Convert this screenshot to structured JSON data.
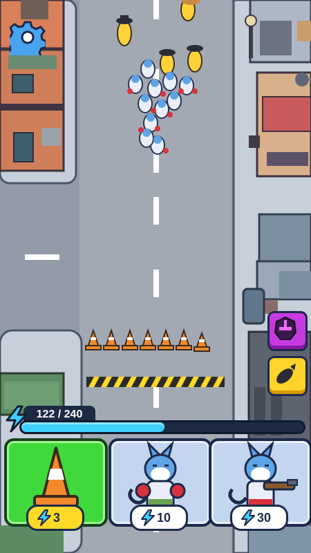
{
  "hud": {
    "energy": {
      "current": 122,
      "max": 240,
      "label": "122 / 240",
      "fill_fraction": 0.508
    },
    "settings_icon": "gear-icon",
    "power_icon": "mech-helmet-icon",
    "bomb_icon": "bomb-icon"
  },
  "cards": [
    {
      "unit": "traffic-cone",
      "cost": "3",
      "selected": true
    },
    {
      "unit": "boxer-cat",
      "cost": "10",
      "selected": false
    },
    {
      "unit": "gunner-cat",
      "cost": "30",
      "selected": false
    }
  ],
  "colors": {
    "energy": "#3fd0ff",
    "card_selected": "#40d93b",
    "card_default": "#c4d6ef",
    "cost_selected": "#ffd927",
    "power_button": "#c53be0",
    "bomb_button": "#ffd32a"
  }
}
